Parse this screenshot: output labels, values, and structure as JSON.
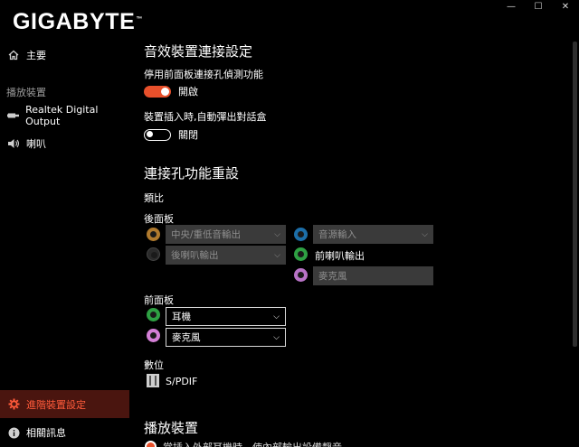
{
  "window": {
    "minimize": "—",
    "maximize": "☐",
    "close": "✕"
  },
  "brand": {
    "logo": "GIGABYTE"
  },
  "sidebar": {
    "home": "主要",
    "playback_section": "播放裝置",
    "device_realtek": "Realtek Digital Output",
    "device_speaker": "喇叭",
    "advanced": "進階裝置設定",
    "about": "相關訊息"
  },
  "main": {
    "section1_title": "音效裝置連接設定",
    "front_detect_label": "停用前面板連接孔偵測功能",
    "front_detect_state": "開啟",
    "popup_label": "裝置插入時,自動彈出對話盒",
    "popup_state": "關閉",
    "section2_title": "連接孔功能重設",
    "analog_label": "類比",
    "rear_panel_label": "後面板",
    "rear": {
      "orange_dropdown": "中央/重低音輸出",
      "black_dropdown": "後喇叭輸出",
      "blue_dropdown": "音源輸入",
      "green_label": "前喇叭輸出",
      "pink_dropdown": "麥克風"
    },
    "front_panel_label": "前面板",
    "front": {
      "green_dropdown": "耳機",
      "pink_dropdown": "麥克風"
    },
    "digital_label": "數位",
    "spdif_label": "S/PDIF",
    "section3_title": "播放裝置",
    "section3_partial": "當插入外部耳機時，使內部輸出設備靜音。"
  },
  "colors": {
    "accent": "#e8502b",
    "jack_orange": "#b07a2e",
    "jack_black": "#2a2a2a",
    "jack_blue": "#1c6ea8",
    "jack_green": "#2ea043",
    "jack_pink": "#b873c6",
    "jack_pink_front": "#d37fd6"
  }
}
